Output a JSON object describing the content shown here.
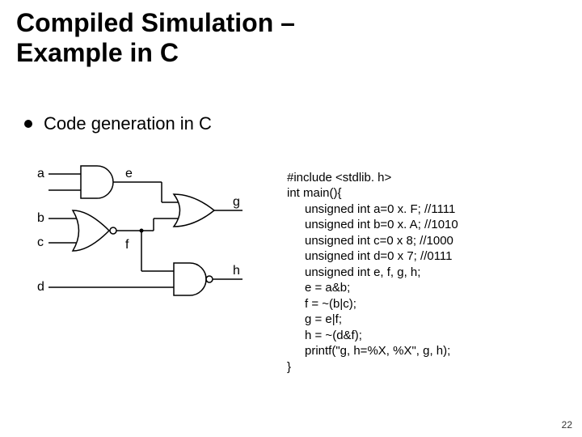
{
  "title_line1": "Compiled Simulation –",
  "title_line2": "Example in C",
  "bullet": "Code generation in C",
  "signals": {
    "a": "a",
    "b": "b",
    "c": "c",
    "d": "d",
    "e": "e",
    "f": "f",
    "g": "g",
    "h": "h"
  },
  "code": {
    "l1": "#include <stdlib. h>",
    "l2": "int main(){",
    "l3": "unsigned int a=0 x. F; //1111",
    "l4": "unsigned int b=0 x. A; //1010",
    "l5": "unsigned int c=0 x 8; //1000",
    "l6": "unsigned int d=0 x 7; //0111",
    "l7": "unsigned int e, f, g, h;",
    "l8": "e = a&b;",
    "l9": "f = ~(b|c);",
    "l10": "g = e|f;",
    "l11": "h = ~(d&f);",
    "l12": "printf(\"g, h=%X, %X\", g, h);",
    "l13": "}"
  },
  "page": "22"
}
